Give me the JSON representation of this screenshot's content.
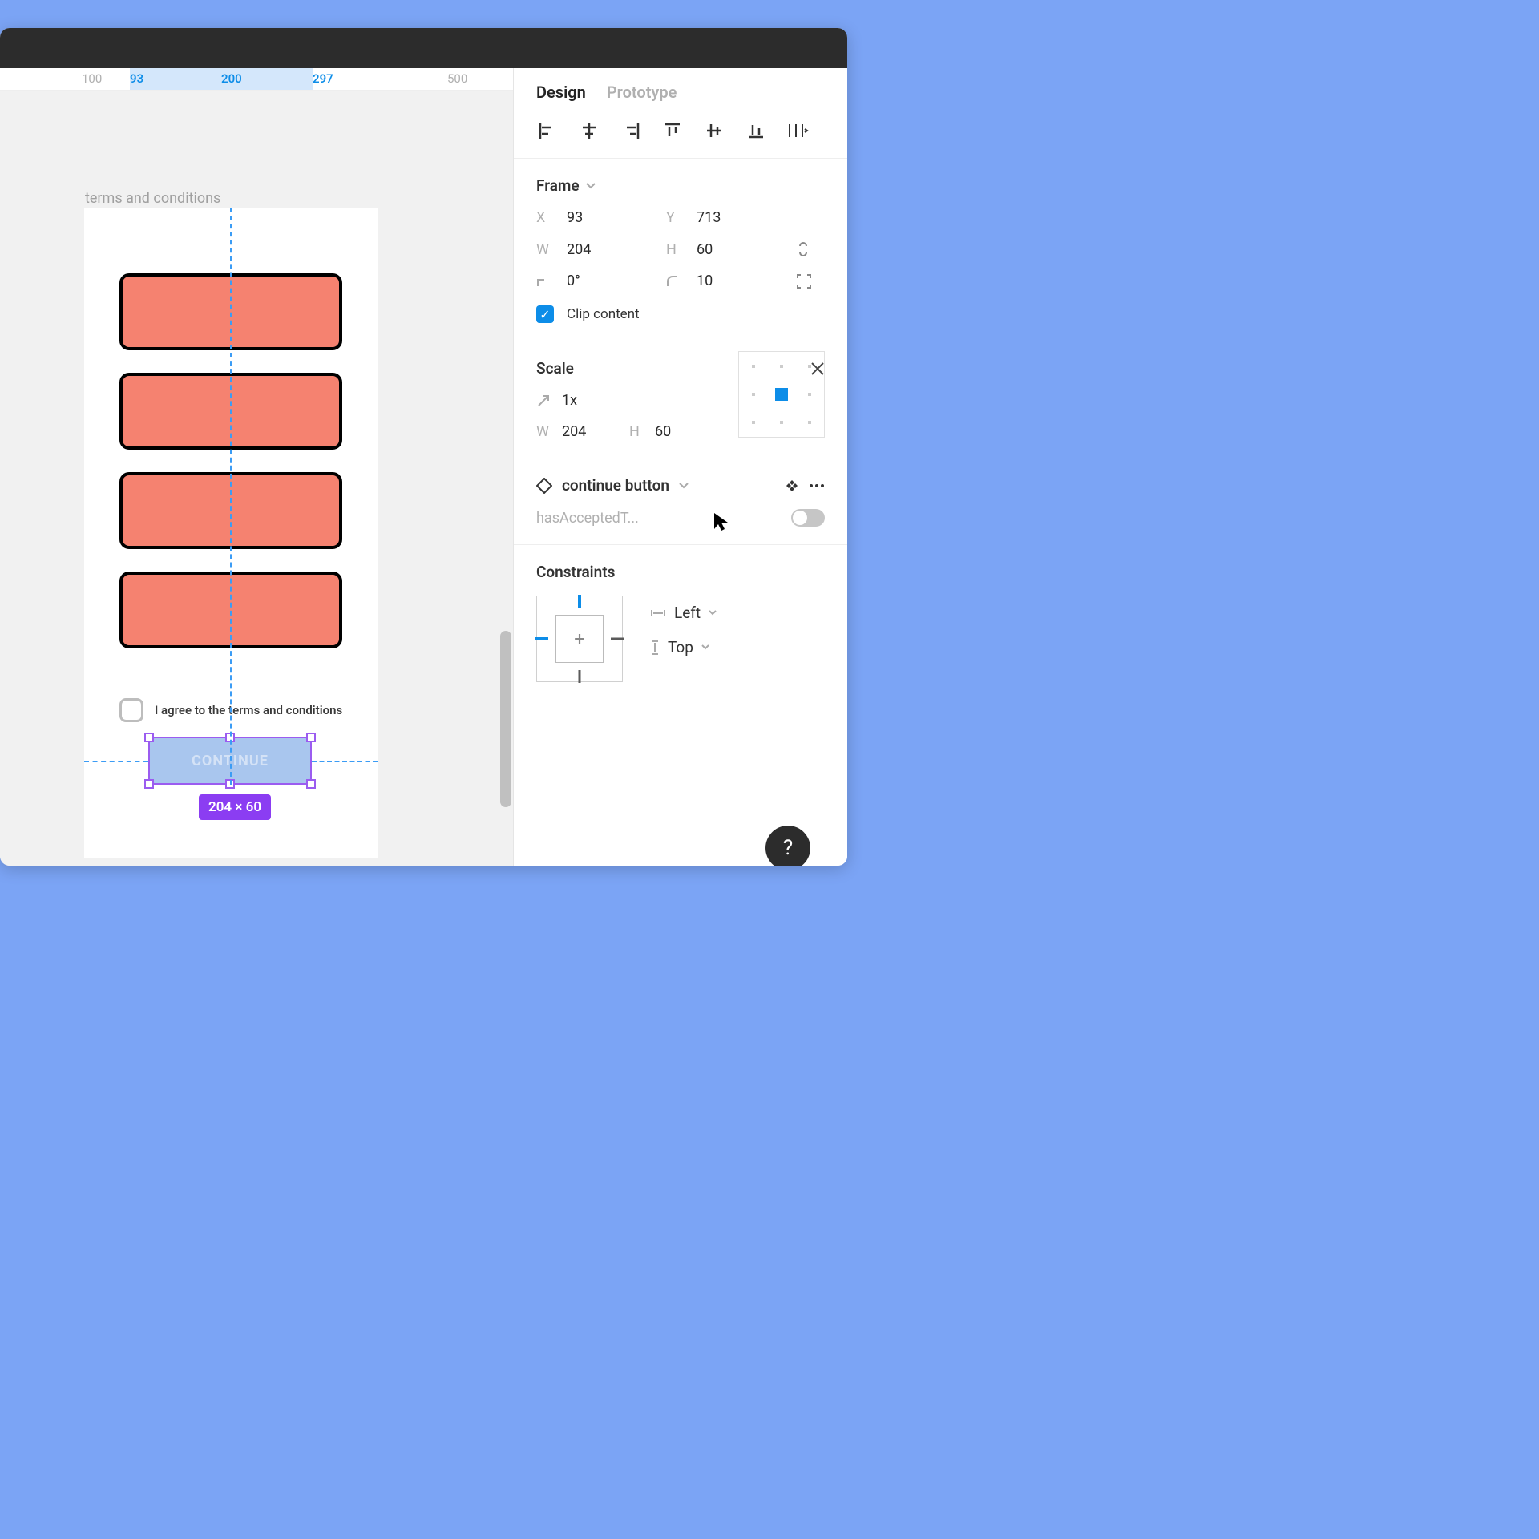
{
  "ruler": {
    "ticks": [
      "100",
      "93",
      "200",
      "297",
      "500"
    ],
    "highlight_start": 93,
    "highlight_end": 297
  },
  "canvas": {
    "frame_label": "terms and conditions",
    "checkbox_text": "I agree to the terms and conditions",
    "continue_label": "CONTINUE",
    "selection_dims": "204 × 60"
  },
  "inspector": {
    "tabs": {
      "design": "Design",
      "prototype": "Prototype"
    },
    "frame": {
      "title": "Frame",
      "x": "93",
      "y": "713",
      "w": "204",
      "h": "60",
      "rotation": "0°",
      "radius": "10",
      "clip_label": "Clip content"
    },
    "scale": {
      "title": "Scale",
      "factor": "1x",
      "w": "204",
      "h": "60"
    },
    "component": {
      "name": "continue button",
      "prop_name": "hasAcceptedT..."
    },
    "constraints": {
      "title": "Constraints",
      "horizontal": "Left",
      "vertical": "Top"
    },
    "labels": {
      "x": "X",
      "y": "Y",
      "w": "W",
      "h": "H"
    },
    "help": "?"
  }
}
